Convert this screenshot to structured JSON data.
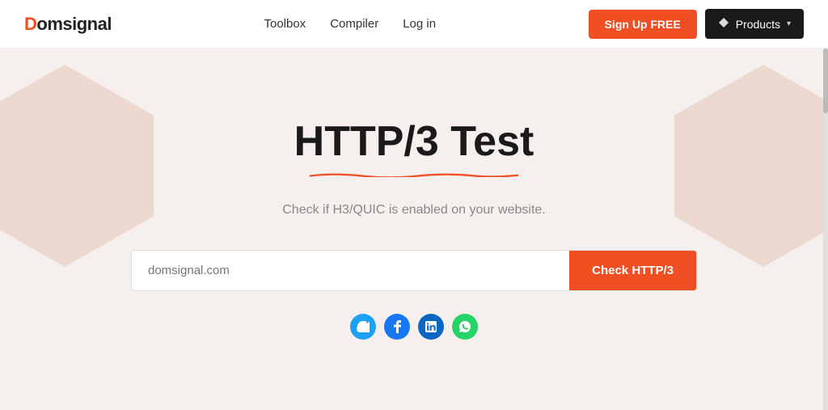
{
  "navbar": {
    "logo_text": "Domsignal",
    "logo_d": "D",
    "links": [
      {
        "label": "Toolbox"
      },
      {
        "label": "Compiler"
      },
      {
        "label": "Log in"
      }
    ],
    "signup_label": "Sign Up FREE",
    "products_label": "Products"
  },
  "hero": {
    "title": "HTTP/3 Test",
    "subtitle": "Check if H3/QUIC is enabled on your website.",
    "input_placeholder": "domsignal.com",
    "check_button_label": "Check HTTP/3"
  },
  "social": {
    "twitter_label": "t",
    "facebook_label": "f",
    "linkedin_label": "in",
    "whatsapp_label": "w"
  },
  "colors": {
    "accent": "#f04e23",
    "dark": "#1a1a1a",
    "bg": "#f5f0ee"
  }
}
